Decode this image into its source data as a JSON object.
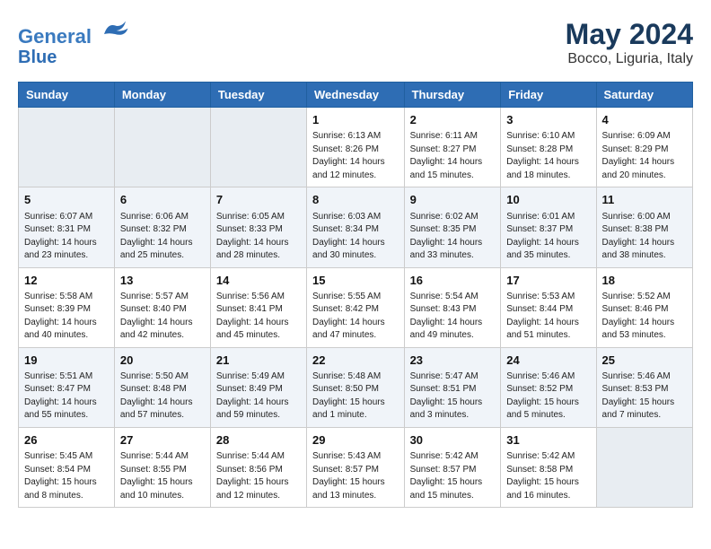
{
  "header": {
    "logo_line1": "General",
    "logo_line2": "Blue",
    "main_title": "May 2024",
    "subtitle": "Bocco, Liguria, Italy"
  },
  "days_of_week": [
    "Sunday",
    "Monday",
    "Tuesday",
    "Wednesday",
    "Thursday",
    "Friday",
    "Saturday"
  ],
  "weeks": [
    [
      {
        "day": "",
        "info": ""
      },
      {
        "day": "",
        "info": ""
      },
      {
        "day": "",
        "info": ""
      },
      {
        "day": "1",
        "info": "Sunrise: 6:13 AM\nSunset: 8:26 PM\nDaylight: 14 hours\nand 12 minutes."
      },
      {
        "day": "2",
        "info": "Sunrise: 6:11 AM\nSunset: 8:27 PM\nDaylight: 14 hours\nand 15 minutes."
      },
      {
        "day": "3",
        "info": "Sunrise: 6:10 AM\nSunset: 8:28 PM\nDaylight: 14 hours\nand 18 minutes."
      },
      {
        "day": "4",
        "info": "Sunrise: 6:09 AM\nSunset: 8:29 PM\nDaylight: 14 hours\nand 20 minutes."
      }
    ],
    [
      {
        "day": "5",
        "info": "Sunrise: 6:07 AM\nSunset: 8:31 PM\nDaylight: 14 hours\nand 23 minutes."
      },
      {
        "day": "6",
        "info": "Sunrise: 6:06 AM\nSunset: 8:32 PM\nDaylight: 14 hours\nand 25 minutes."
      },
      {
        "day": "7",
        "info": "Sunrise: 6:05 AM\nSunset: 8:33 PM\nDaylight: 14 hours\nand 28 minutes."
      },
      {
        "day": "8",
        "info": "Sunrise: 6:03 AM\nSunset: 8:34 PM\nDaylight: 14 hours\nand 30 minutes."
      },
      {
        "day": "9",
        "info": "Sunrise: 6:02 AM\nSunset: 8:35 PM\nDaylight: 14 hours\nand 33 minutes."
      },
      {
        "day": "10",
        "info": "Sunrise: 6:01 AM\nSunset: 8:37 PM\nDaylight: 14 hours\nand 35 minutes."
      },
      {
        "day": "11",
        "info": "Sunrise: 6:00 AM\nSunset: 8:38 PM\nDaylight: 14 hours\nand 38 minutes."
      }
    ],
    [
      {
        "day": "12",
        "info": "Sunrise: 5:58 AM\nSunset: 8:39 PM\nDaylight: 14 hours\nand 40 minutes."
      },
      {
        "day": "13",
        "info": "Sunrise: 5:57 AM\nSunset: 8:40 PM\nDaylight: 14 hours\nand 42 minutes."
      },
      {
        "day": "14",
        "info": "Sunrise: 5:56 AM\nSunset: 8:41 PM\nDaylight: 14 hours\nand 45 minutes."
      },
      {
        "day": "15",
        "info": "Sunrise: 5:55 AM\nSunset: 8:42 PM\nDaylight: 14 hours\nand 47 minutes."
      },
      {
        "day": "16",
        "info": "Sunrise: 5:54 AM\nSunset: 8:43 PM\nDaylight: 14 hours\nand 49 minutes."
      },
      {
        "day": "17",
        "info": "Sunrise: 5:53 AM\nSunset: 8:44 PM\nDaylight: 14 hours\nand 51 minutes."
      },
      {
        "day": "18",
        "info": "Sunrise: 5:52 AM\nSunset: 8:46 PM\nDaylight: 14 hours\nand 53 minutes."
      }
    ],
    [
      {
        "day": "19",
        "info": "Sunrise: 5:51 AM\nSunset: 8:47 PM\nDaylight: 14 hours\nand 55 minutes."
      },
      {
        "day": "20",
        "info": "Sunrise: 5:50 AM\nSunset: 8:48 PM\nDaylight: 14 hours\nand 57 minutes."
      },
      {
        "day": "21",
        "info": "Sunrise: 5:49 AM\nSunset: 8:49 PM\nDaylight: 14 hours\nand 59 minutes."
      },
      {
        "day": "22",
        "info": "Sunrise: 5:48 AM\nSunset: 8:50 PM\nDaylight: 15 hours\nand 1 minute."
      },
      {
        "day": "23",
        "info": "Sunrise: 5:47 AM\nSunset: 8:51 PM\nDaylight: 15 hours\nand 3 minutes."
      },
      {
        "day": "24",
        "info": "Sunrise: 5:46 AM\nSunset: 8:52 PM\nDaylight: 15 hours\nand 5 minutes."
      },
      {
        "day": "25",
        "info": "Sunrise: 5:46 AM\nSunset: 8:53 PM\nDaylight: 15 hours\nand 7 minutes."
      }
    ],
    [
      {
        "day": "26",
        "info": "Sunrise: 5:45 AM\nSunset: 8:54 PM\nDaylight: 15 hours\nand 8 minutes."
      },
      {
        "day": "27",
        "info": "Sunrise: 5:44 AM\nSunset: 8:55 PM\nDaylight: 15 hours\nand 10 minutes."
      },
      {
        "day": "28",
        "info": "Sunrise: 5:44 AM\nSunset: 8:56 PM\nDaylight: 15 hours\nand 12 minutes."
      },
      {
        "day": "29",
        "info": "Sunrise: 5:43 AM\nSunset: 8:57 PM\nDaylight: 15 hours\nand 13 minutes."
      },
      {
        "day": "30",
        "info": "Sunrise: 5:42 AM\nSunset: 8:57 PM\nDaylight: 15 hours\nand 15 minutes."
      },
      {
        "day": "31",
        "info": "Sunrise: 5:42 AM\nSunset: 8:58 PM\nDaylight: 15 hours\nand 16 minutes."
      },
      {
        "day": "",
        "info": ""
      }
    ]
  ]
}
